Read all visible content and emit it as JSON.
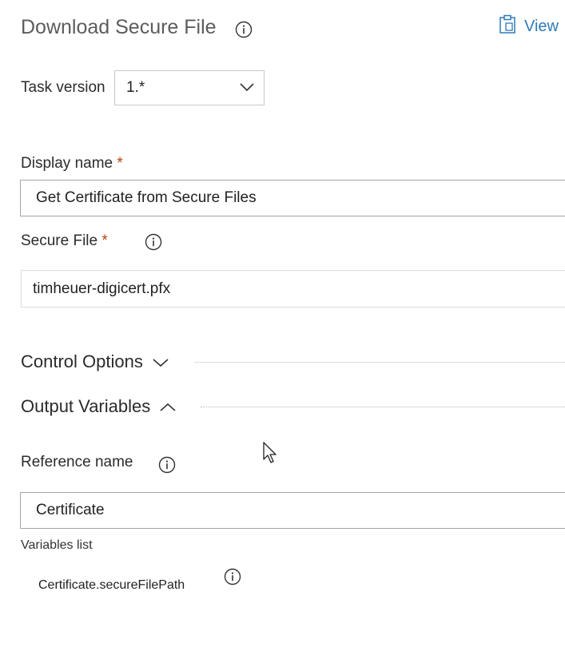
{
  "header": {
    "title": "Download Secure File",
    "view_label": "View"
  },
  "task_version": {
    "label": "Task version",
    "value": "1.*"
  },
  "display_name": {
    "label": "Display name",
    "required_mark": "*",
    "value": "Get Certificate from Secure Files"
  },
  "secure_file": {
    "label": "Secure File",
    "required_mark": "*",
    "value": "timheuer-digicert.pfx"
  },
  "sections": {
    "control_options": "Control Options",
    "output_variables": "Output Variables"
  },
  "reference_name": {
    "label": "Reference name",
    "value": "Certificate"
  },
  "variables": {
    "label": "Variables list",
    "items": [
      "Certificate.secureFilePath"
    ]
  },
  "colors": {
    "accent": "#2f7ab8",
    "required": "#b2450c",
    "title": "#5c5c5c"
  },
  "icons": [
    "info-icon",
    "clipboard-icon",
    "chevron-down-icon",
    "chevron-up-icon",
    "mouse-cursor-icon"
  ]
}
